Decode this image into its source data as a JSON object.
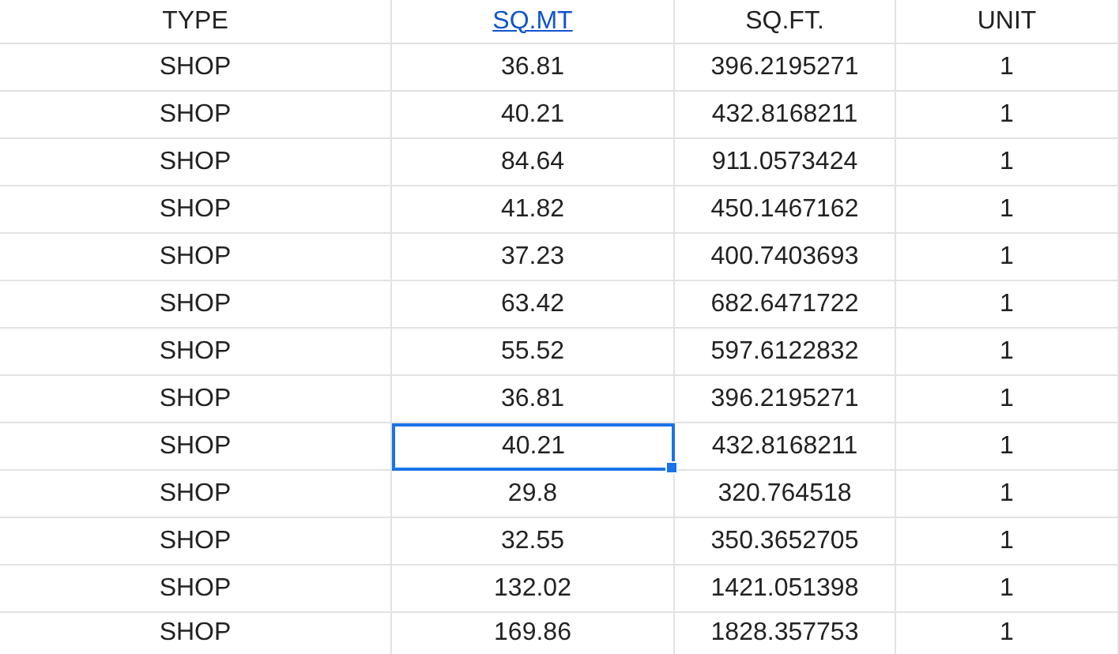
{
  "table": {
    "columns": [
      {
        "label": "TYPE",
        "kind": "text"
      },
      {
        "label": "SQ.MT",
        "kind": "link"
      },
      {
        "label": "SQ.FT.",
        "kind": "text"
      },
      {
        "label": "UNIT",
        "kind": "text"
      }
    ],
    "rows": [
      {
        "cells": [
          {
            "text": "SHOP",
            "selected": false
          },
          {
            "text": "36.81",
            "selected": false
          },
          {
            "text": "396.2195271",
            "selected": false
          },
          {
            "text": "1",
            "selected": false
          }
        ]
      },
      {
        "cells": [
          {
            "text": "SHOP",
            "selected": false
          },
          {
            "text": "40.21",
            "selected": false
          },
          {
            "text": "432.8168211",
            "selected": false
          },
          {
            "text": "1",
            "selected": false
          }
        ]
      },
      {
        "cells": [
          {
            "text": "SHOP",
            "selected": false
          },
          {
            "text": "84.64",
            "selected": false
          },
          {
            "text": "911.0573424",
            "selected": false
          },
          {
            "text": "1",
            "selected": false
          }
        ]
      },
      {
        "cells": [
          {
            "text": "SHOP",
            "selected": false
          },
          {
            "text": "41.82",
            "selected": false
          },
          {
            "text": "450.1467162",
            "selected": false
          },
          {
            "text": "1",
            "selected": false
          }
        ]
      },
      {
        "cells": [
          {
            "text": "SHOP",
            "selected": false
          },
          {
            "text": "37.23",
            "selected": false
          },
          {
            "text": "400.7403693",
            "selected": false
          },
          {
            "text": "1",
            "selected": false
          }
        ]
      },
      {
        "cells": [
          {
            "text": "SHOP",
            "selected": false
          },
          {
            "text": "63.42",
            "selected": false
          },
          {
            "text": "682.6471722",
            "selected": false
          },
          {
            "text": "1",
            "selected": false
          }
        ]
      },
      {
        "cells": [
          {
            "text": "SHOP",
            "selected": false
          },
          {
            "text": "55.52",
            "selected": false
          },
          {
            "text": "597.6122832",
            "selected": false
          },
          {
            "text": "1",
            "selected": false
          }
        ]
      },
      {
        "cells": [
          {
            "text": "SHOP",
            "selected": false
          },
          {
            "text": "36.81",
            "selected": false
          },
          {
            "text": "396.2195271",
            "selected": false
          },
          {
            "text": "1",
            "selected": false
          }
        ]
      },
      {
        "cells": [
          {
            "text": "SHOP",
            "selected": false
          },
          {
            "text": "40.21",
            "selected": true
          },
          {
            "text": "432.8168211",
            "selected": false
          },
          {
            "text": "1",
            "selected": false
          }
        ]
      },
      {
        "cells": [
          {
            "text": "SHOP",
            "selected": false
          },
          {
            "text": "29.8",
            "selected": false
          },
          {
            "text": "320.764518",
            "selected": false
          },
          {
            "text": "1",
            "selected": false
          }
        ]
      },
      {
        "cells": [
          {
            "text": "SHOP",
            "selected": false
          },
          {
            "text": "32.55",
            "selected": false
          },
          {
            "text": "350.3652705",
            "selected": false
          },
          {
            "text": "1",
            "selected": false
          }
        ]
      },
      {
        "cells": [
          {
            "text": "SHOP",
            "selected": false
          },
          {
            "text": "132.02",
            "selected": false
          },
          {
            "text": "1421.051398",
            "selected": false
          },
          {
            "text": "1",
            "selected": false
          }
        ]
      },
      {
        "cells": [
          {
            "text": "SHOP",
            "selected": false
          },
          {
            "text": "169.86",
            "selected": false
          },
          {
            "text": "1828.357753",
            "selected": false
          },
          {
            "text": "1",
            "selected": false
          }
        ]
      }
    ]
  }
}
